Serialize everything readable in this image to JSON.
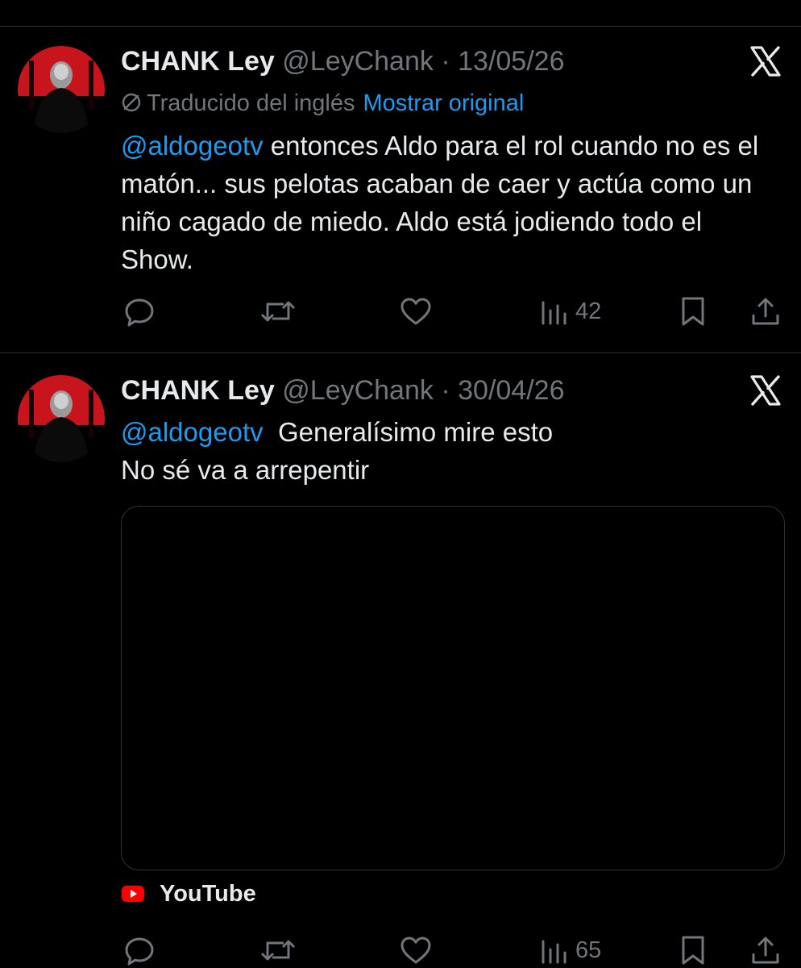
{
  "colors": {
    "background": "#000000",
    "text": "#e7e9ea",
    "muted": "#71767b",
    "accent": "#1d9bf0",
    "divider": "#2f3336",
    "youtube_red": "#ff0000"
  },
  "tweets": [
    {
      "author_name": "CHANK Ley",
      "handle": "@LeyChank",
      "separator": "·",
      "date": "13/05/26",
      "translated_label": "Traducido del inglés",
      "show_original": "Mostrar original",
      "mention": "@aldogeotv",
      "text": " entonces Aldo para el rol cuando no es el matón... sus pelotas acaban de caer y actúa como un niño cagado de miedo. Aldo está jodiendo todo el Show.",
      "views": "42",
      "icons": [
        "x-logo",
        "reply-icon",
        "retweet-icon",
        "like-icon",
        "views-icon",
        "bookmark-icon",
        "share-icon"
      ]
    },
    {
      "author_name": "CHANK Ley",
      "handle": "@LeyChank",
      "separator": "·",
      "date": "30/04/26",
      "mention": "@aldogeotv",
      "line1": "Generalísimo mire esto",
      "line2": "No sé va a arrepentir",
      "link_source": "YouTube",
      "views": "65",
      "icons": [
        "x-logo",
        "youtube-icon",
        "reply-icon",
        "retweet-icon",
        "like-icon",
        "views-icon",
        "bookmark-icon",
        "share-icon"
      ]
    }
  ]
}
